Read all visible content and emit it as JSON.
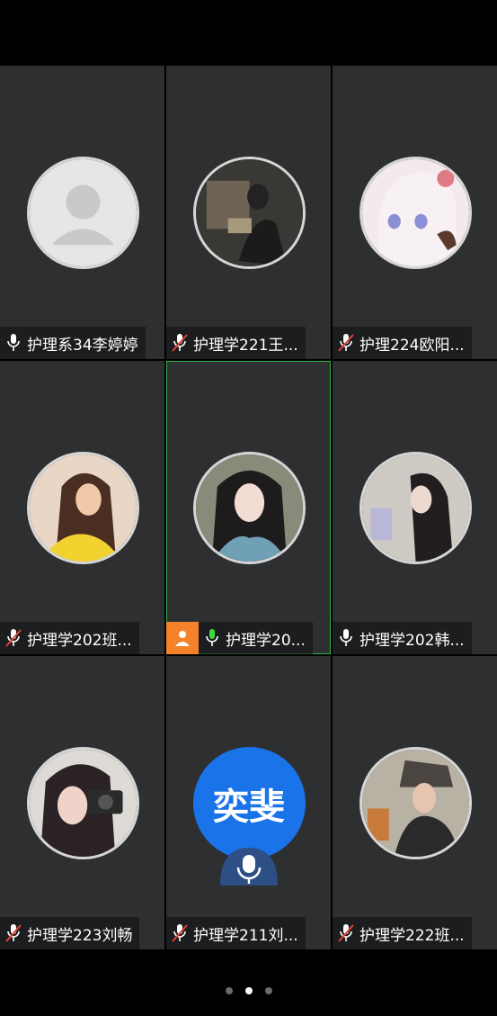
{
  "tiles": [
    {
      "name": "护理系34李婷婷",
      "mic": "on",
      "avatar": "placeholder-avatar"
    },
    {
      "name": "护理学221王...",
      "mic": "muted",
      "avatar": "photo-avatar"
    },
    {
      "name": "护理224欧阳...",
      "mic": "muted",
      "avatar": "anime-avatar"
    },
    {
      "name": "护理学202班...",
      "mic": "muted",
      "avatar": "photo-avatar"
    },
    {
      "name": "护理学20...",
      "mic": "speaking",
      "avatar": "photo-avatar",
      "host": true,
      "active": true
    },
    {
      "name": "护理学202韩...",
      "mic": "on",
      "avatar": "photo-avatar"
    },
    {
      "name": "护理学223刘畅",
      "mic": "muted",
      "avatar": "photo-avatar"
    },
    {
      "name": "护理学211刘...",
      "mic": "muted",
      "avatar": "letter-avatar",
      "letters": "奕斐"
    },
    {
      "name": "护理学222班...",
      "mic": "muted",
      "avatar": "photo-avatar"
    }
  ],
  "pager": {
    "pages": 3,
    "current": 2
  },
  "colors": {
    "tile_bg": "#2d2f31",
    "active_border": "#2fb64a",
    "mic_speaking": "#3ddc3d",
    "mic_muted": "#e0453a",
    "host_badge": "#f5812a",
    "letter_avatar": "#1a73e8"
  }
}
